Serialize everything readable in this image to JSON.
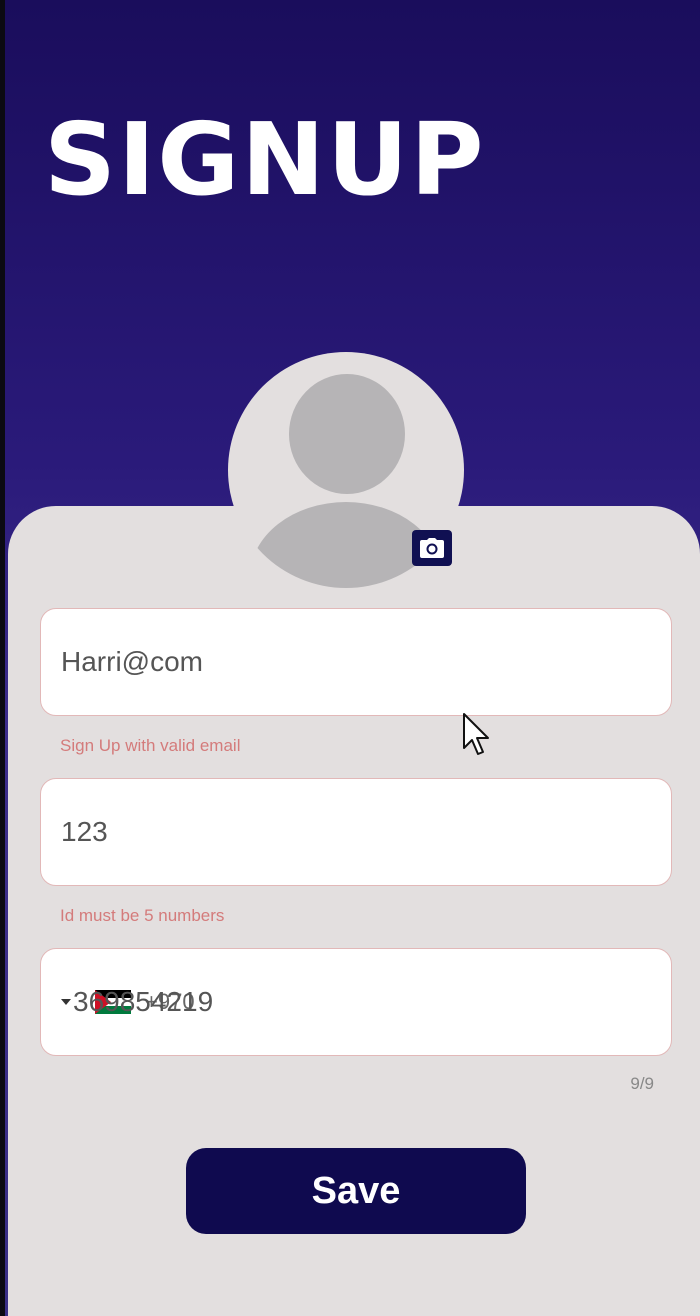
{
  "header": {
    "title": "SIGNUP"
  },
  "avatar": {
    "icon": "person-placeholder-icon",
    "camera_icon": "camera-icon"
  },
  "form": {
    "email": {
      "value": "Harri@com",
      "error": "Sign Up with valid email"
    },
    "id": {
      "value": "123",
      "error": "Id must be 5 numbers"
    },
    "phone": {
      "dial_code": "+970",
      "value": "369854219",
      "counter": "9/9",
      "flag": "palestine-flag-icon"
    }
  },
  "actions": {
    "save_label": "Save"
  },
  "colors": {
    "header_bg": "#2a1a7a",
    "card_bg": "#e3dfdf",
    "button_bg": "#0f0a4f",
    "error": "#d47b7b"
  }
}
